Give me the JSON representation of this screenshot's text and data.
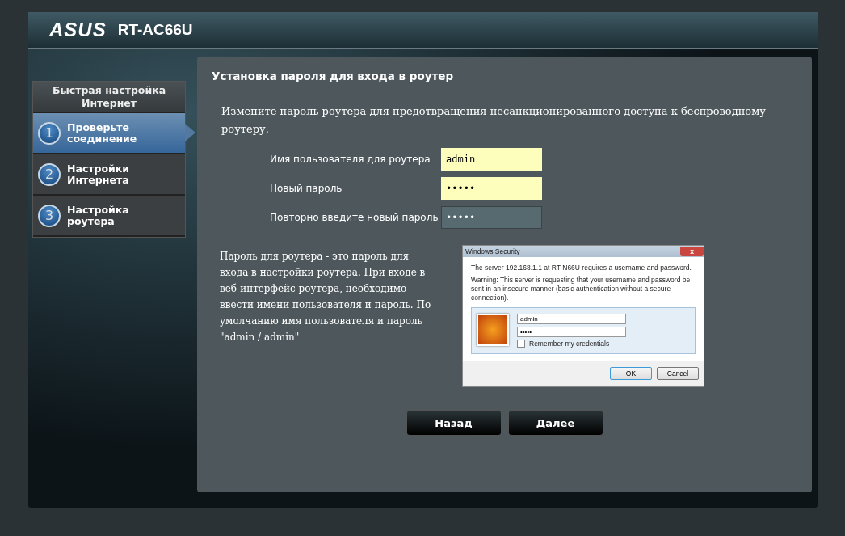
{
  "header": {
    "brand": "ASUS",
    "model": "RT-AC66U"
  },
  "sidebar": {
    "title": "Быстрая настройка Интернет",
    "steps": [
      {
        "number": "1",
        "label": "Проверьте соединение",
        "selected": true
      },
      {
        "number": "2",
        "label": "Настройки Интернета",
        "selected": false
      },
      {
        "number": "3",
        "label": "Настройка роутера",
        "selected": false
      }
    ]
  },
  "panel": {
    "title": "Установка пароля для входа в роутер",
    "intro": "Измените пароль роутера для предотвращения несанкционированного доступа к беспроводному роутеру.",
    "fields": [
      {
        "label": "Имя пользователя для роутера",
        "value": "admin",
        "highlighted": true
      },
      {
        "label": "Новый пароль",
        "value": "•••••",
        "highlighted": true
      },
      {
        "label": "Повторно введите новый пароль",
        "value": "•••••",
        "highlighted": false
      }
    ],
    "note": "Пароль для роутера - это пароль для входа в настройки роутера. При входе в веб-интерфейс роутера, необходимо ввести имени пользователя и пароль. По умолчанию имя пользователя и пароль \"admin / admin\"",
    "dialog": {
      "title": "Windows Security",
      "close": "x",
      "message": "The server 192.168.1.1 at RT-N66U requires a username and password.",
      "warning": "Warning: This server is requesting that your username and password be sent in an insecure manner (basic authentication without a secure connection).",
      "username": "admin",
      "password": "•••••",
      "remember": {
        "label": "Remember my credentials",
        "checked": false
      },
      "buttons": [
        "OK",
        "Cancel"
      ]
    },
    "buttons": [
      "Назад",
      "Далее"
    ]
  }
}
